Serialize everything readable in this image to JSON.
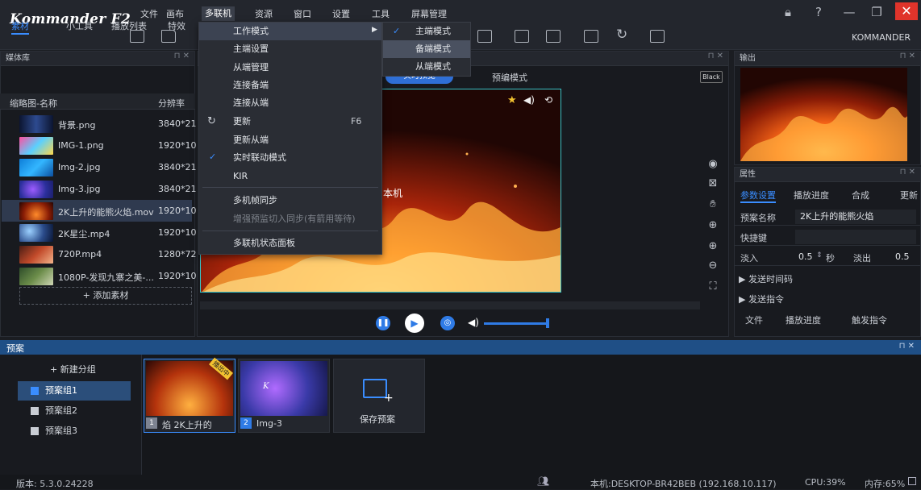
{
  "app": {
    "title": "Kommander F2",
    "user": "KOMMANDER"
  },
  "menubar": [
    "文件",
    "画布",
    "多联机",
    "资源",
    "窗口",
    "设置",
    "工具",
    "屏幕管理"
  ],
  "active_menu": "多联机",
  "dropdown": {
    "items": [
      {
        "label": "工作模式",
        "icon": "expand-icon",
        "has_sub": true
      },
      {
        "label": "主端设置"
      },
      {
        "label": "从端管理"
      },
      {
        "label": "连接备端"
      },
      {
        "label": "连接从端"
      },
      {
        "label": "更新",
        "icon": "refresh-icon",
        "shortcut": "F6"
      },
      {
        "label": "更新从端"
      },
      {
        "label": "实时联动模式",
        "checked": true
      },
      {
        "label": "KIR"
      },
      {
        "label": "多机帧同步"
      },
      {
        "label": "增强预监切入同步(有箭用等待)",
        "disabled": true
      },
      {
        "label": "多联机状态面板"
      }
    ],
    "submenu": [
      {
        "label": "主端模式",
        "checked": true
      },
      {
        "label": "备端模式",
        "highlighted": true
      },
      {
        "label": "从端模式"
      }
    ]
  },
  "media_panel": {
    "title": "媒体库",
    "tabs": [
      "素材",
      "小工具",
      "播放列表",
      "特效"
    ],
    "columns": [
      "缩略图-名称",
      "分辨率"
    ],
    "rows": [
      {
        "name": "背景.png",
        "res": "3840*2160"
      },
      {
        "name": "IMG-1.png",
        "res": "1920*1080"
      },
      {
        "name": "Img-2.jpg",
        "res": "3840*2160"
      },
      {
        "name": "Img-3.jpg",
        "res": "3840*2160"
      },
      {
        "name": "2K上升的能熊火焰.mov",
        "res": "1920*1080"
      },
      {
        "name": "2K星尘.mp4",
        "res": "1920*1080"
      },
      {
        "name": "720P.mp4",
        "res": "1280*720"
      },
      {
        "name": "1080P-发现九寨之美-...",
        "res": "1920*1080"
      }
    ],
    "add_label": "+ 添加素材"
  },
  "preview": {
    "tabs": [
      "实时预览",
      "预编模式"
    ],
    "black_btn": "Black",
    "overlay_text": "本机"
  },
  "output": {
    "title": "输出"
  },
  "properties": {
    "title": "属性",
    "tabs": [
      "参数设置",
      "播放进度",
      "合成",
      "更新"
    ],
    "preset_name_label": "预案名称",
    "preset_name_value": "2K上升的能熊火焰",
    "hotkey_label": "快捷键",
    "fadein_label": "淡入",
    "fadein_value": "0.5",
    "fadein_unit": "秒",
    "fadeout_label": "淡出",
    "fadeout_value": "0.5",
    "send_time": "▶ 发送时间码",
    "send_cmd": "▶ 发送指令",
    "cols": [
      "文件",
      "播放进度",
      "触发指令"
    ]
  },
  "presets": {
    "title": "预案",
    "new_group": "+ 新建分组",
    "groups": [
      "预案组1",
      "预案组2",
      "预案组3"
    ],
    "cards": [
      {
        "num": "1",
        "label": "焰 2K上升的",
        "badge": "播出中"
      },
      {
        "num": "2",
        "label": "Img-3"
      }
    ],
    "save_label": "保存预案"
  },
  "status": {
    "version": "版本: 5.3.0.24228",
    "host": "本机:DESKTOP-BR42BEB (192.168.10.117)",
    "cpu": "CPU:39%",
    "mem": "内存:65%"
  },
  "colors": {
    "accent": "#3a8dff",
    "close": "#e0342b",
    "border_active": "#35c4c8"
  }
}
